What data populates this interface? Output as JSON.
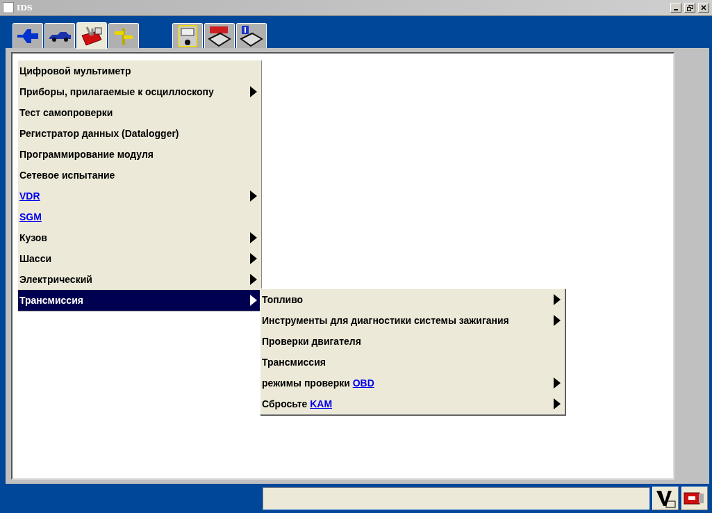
{
  "window": {
    "title": "IDS"
  },
  "tabs": [
    {
      "kind": "connector",
      "selected": false
    },
    {
      "kind": "car",
      "selected": false
    },
    {
      "kind": "toolbox",
      "selected": true
    },
    {
      "kind": "signpost",
      "selected": false
    }
  ],
  "tool_tabs": [
    {
      "kind": "multimeter",
      "selected": false
    },
    {
      "kind": "dtc",
      "selected": false
    },
    {
      "kind": "info",
      "selected": false
    }
  ],
  "menu": {
    "items": [
      {
        "text": "Цифровой мультиметр",
        "submenu": false,
        "selected": false
      },
      {
        "text": "Приборы, прилагаемые к осциллоскопу",
        "submenu": true,
        "selected": false
      },
      {
        "text": "Тест самопроверки",
        "submenu": false,
        "selected": false
      },
      {
        "text": "Регистратор данных (Datalogger)",
        "submenu": false,
        "selected": false
      },
      {
        "text": "Программирование модуля",
        "submenu": false,
        "selected": false
      },
      {
        "text": "Сетевое испытание",
        "submenu": false,
        "selected": false
      },
      {
        "link": "VDR",
        "submenu": true,
        "selected": false
      },
      {
        "link": "SGM",
        "submenu": false,
        "selected": false
      },
      {
        "text": "Кузов",
        "submenu": true,
        "selected": false
      },
      {
        "text": "Шасси",
        "submenu": true,
        "selected": false
      },
      {
        "text": "Электрический",
        "submenu": true,
        "selected": false
      },
      {
        "text": "Трансмиссия",
        "submenu": true,
        "selected": true
      }
    ]
  },
  "submenu": {
    "items": [
      {
        "text": "Топливо",
        "submenu": true,
        "selected": false
      },
      {
        "text": "Инструменты для диагностики системы зажигания",
        "submenu": true,
        "selected": false
      },
      {
        "text": "Проверки двигателя",
        "submenu": false,
        "selected": false
      },
      {
        "text": "Трансмиссия",
        "submenu": false,
        "selected": false
      },
      {
        "text": "режимы проверки ",
        "link": "OBD",
        "submenu": true,
        "selected": false
      },
      {
        "text": "Сбросьте ",
        "link": "KAM",
        "submenu": true,
        "selected": false
      }
    ]
  },
  "status_bar": {
    "buttons": [
      {
        "kind": "voltage"
      },
      {
        "kind": "battery"
      }
    ]
  }
}
